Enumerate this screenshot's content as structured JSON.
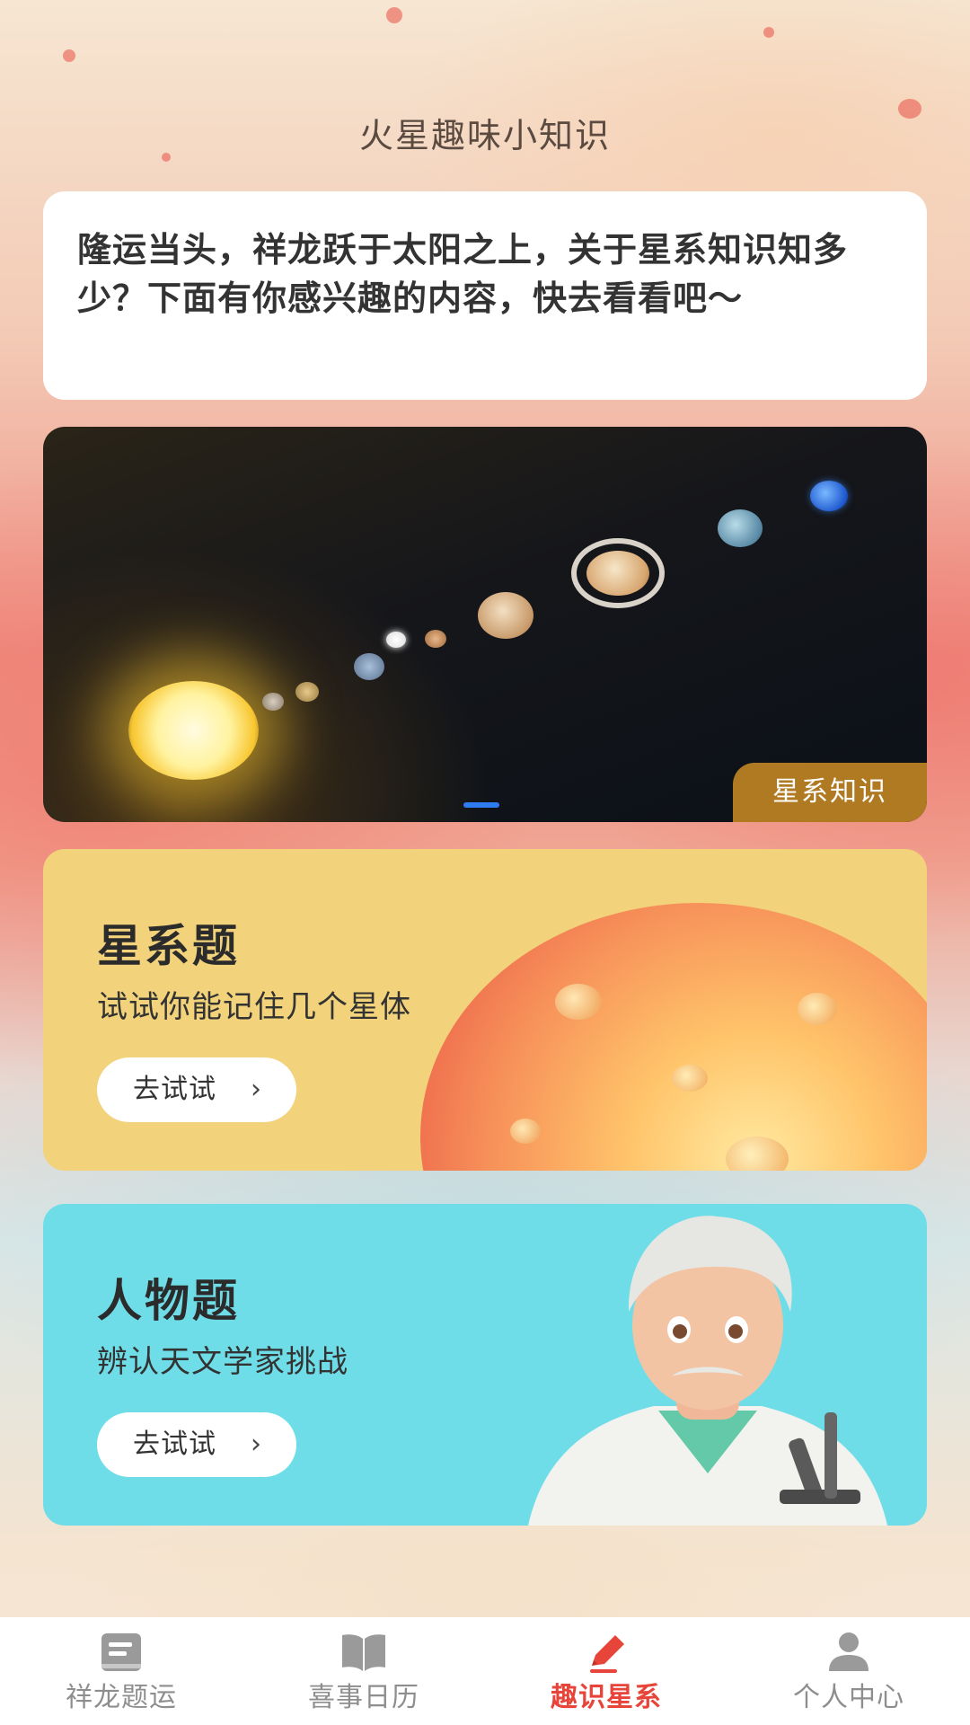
{
  "header": {
    "title": "火星趣味小知识"
  },
  "intro": {
    "text": "隆运当头，祥龙跃于太阳之上，关于星系知识知多少？下面有你感兴趣的内容，快去看看吧～"
  },
  "banner": {
    "tag": "星系知识",
    "page_count": 1,
    "active_index": 0
  },
  "quizzes": [
    {
      "title": "星系题",
      "subtitle": "试试你能记住几个星体",
      "button": "去试试",
      "chevron": "›",
      "bg": "#f2d27a",
      "illustration": "planet-illustration"
    },
    {
      "title": "人物题",
      "subtitle": "辨认天文学家挑战",
      "button": "去试试",
      "chevron": "›",
      "bg": "#6fdde8",
      "illustration": "astronomer-illustration"
    }
  ],
  "tabbar": {
    "items": [
      {
        "label": "祥龙题运",
        "icon": "book-icon",
        "active": false
      },
      {
        "label": "喜事日历",
        "icon": "open-book-icon",
        "active": false
      },
      {
        "label": "趣识星系",
        "icon": "pencil-icon",
        "active": true
      },
      {
        "label": "个人中心",
        "icon": "person-icon",
        "active": false
      }
    ]
  },
  "colors": {
    "accent": "#e8453a",
    "banner_tag": "#b07a22",
    "dot_active": "#2f7cf0",
    "tab_inactive": "#8e8e8e"
  }
}
